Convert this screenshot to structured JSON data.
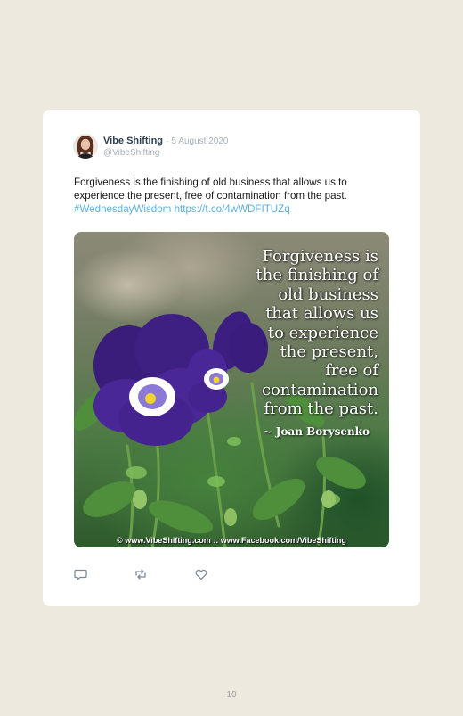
{
  "tweet": {
    "author_name": "Vibe Shifting",
    "separator": "·",
    "date": "5 August 2020",
    "handle": "@VibeShifting",
    "text": "Forgiveness is the finishing of old business that allows us to experience the present, free of contamination from the past.",
    "hashtag": "#WednesdayWisdom",
    "url": "https://t.co/4wWDFITUZq",
    "image": {
      "quote_lines": [
        "Forgiveness is",
        "the finishing of",
        "old business",
        "that allows us",
        "to experience",
        "the present,",
        "free of",
        "contamination",
        "from the past."
      ],
      "attribution": "~ Joan Borysenko",
      "credit": "© www.VibeShifting.com :: www.Facebook.com/VibeShifting"
    },
    "actions": [
      {
        "name": "reply",
        "icon": "reply-icon"
      },
      {
        "name": "retweet",
        "icon": "retweet-icon"
      },
      {
        "name": "like",
        "icon": "heart-icon"
      }
    ]
  },
  "colors": {
    "background": "#eee9df",
    "card": "#ffffff",
    "link": "#5ab0dc",
    "name": "#2c3e50",
    "muted": "#a7b0b8"
  },
  "page": {
    "number": "10"
  }
}
